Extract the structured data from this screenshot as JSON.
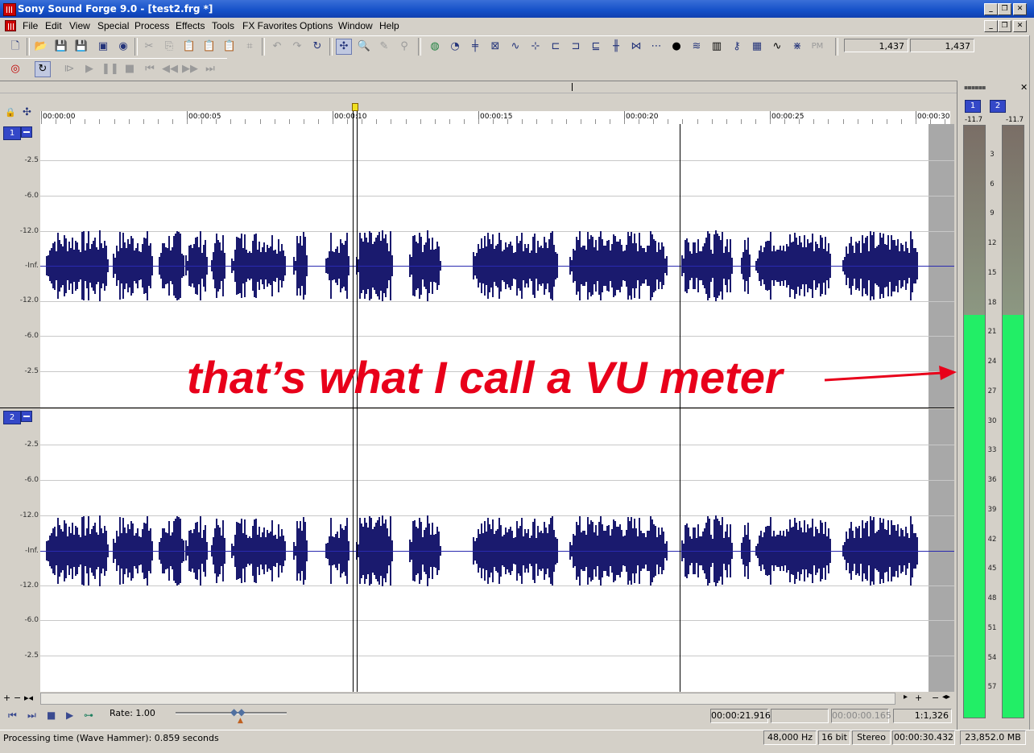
{
  "window": {
    "title": "Sony Sound Forge 9.0 - [test2.frg *]"
  },
  "menu": [
    "File",
    "Edit",
    "View",
    "Special",
    "Process",
    "Effects",
    "Tools",
    "FX Favorites",
    "Options",
    "Window",
    "Help"
  ],
  "toolbar": {
    "field1": "1,437",
    "field2": "1,437"
  },
  "ruler": [
    "00:00:00",
    "00:00:05",
    "00:00:10",
    "00:00:15",
    "00:00:20",
    "00:00:25",
    "00:00:30"
  ],
  "channels": [
    {
      "label": "1",
      "db_labels": [
        "-2.5",
        "-6.0",
        "-12.0",
        "-Inf.",
        "-12.0",
        "-6.0",
        "-2.5"
      ]
    },
    {
      "label": "2",
      "db_labels": [
        "-2.5",
        "-6.0",
        "-12.0",
        "-Inf.",
        "-12.0",
        "-6.0",
        "-2.5"
      ]
    }
  ],
  "annotation": "that’s what I call a VU meter",
  "meter": {
    "channels": [
      "1",
      "2"
    ],
    "peak": [
      "-11.7",
      "-11.7"
    ],
    "scale": [
      "3",
      "6",
      "9",
      "12",
      "15",
      "18",
      "21",
      "24",
      "27",
      "30",
      "33",
      "36",
      "39",
      "42",
      "45",
      "48",
      "51",
      "54",
      "57"
    ],
    "level_fraction": 0.68,
    "colors": {
      "level": "#22ee66",
      "empty_top": "#7a6e66",
      "empty_bottom": "#8c9882"
    }
  },
  "transport": {
    "rate": "Rate: 1.00"
  },
  "selection": {
    "start": "00:00:21.916",
    "end": "",
    "length": "00:00:00.165",
    "zoom": "1:1,326"
  },
  "status": {
    "text": "Processing time (Wave Hammer): 0.859 seconds",
    "rate": "48,000 Hz",
    "bits": "16 bit",
    "channels": "Stereo",
    "length": "00:00:30.432",
    "memory": "23,852.0 MB"
  },
  "colors": {
    "waveform": "#1a1a6e",
    "annotation": "#e8001a",
    "titlebar": "#1450c8"
  }
}
